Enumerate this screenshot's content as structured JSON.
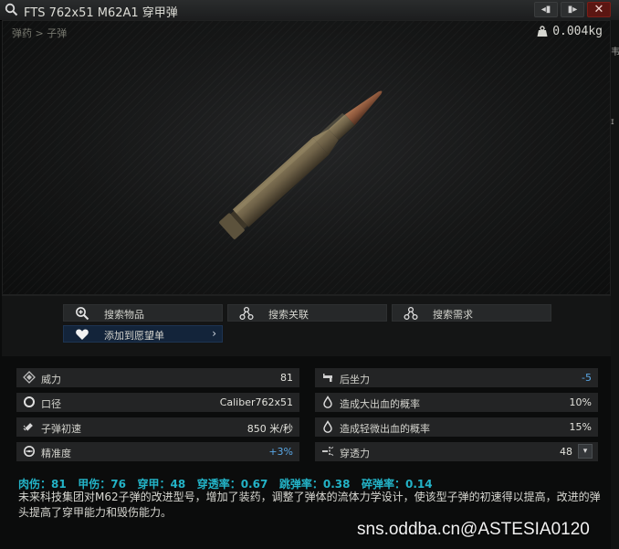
{
  "window": {
    "title": "FTS 762x51 M62A1 穿甲弹",
    "btn_left_glyph": "◂▮",
    "btn_right_glyph": "▮▸",
    "btn_close_glyph": "✕",
    "edge_char_1": "韦",
    "edge_char_2": "ɪ"
  },
  "viewer": {
    "breadcrumb": "弹药 > 子弹",
    "weight": "0.004kg"
  },
  "actions": {
    "search_item": "搜索物品",
    "search_related": "搜索关联",
    "search_needs": "搜索需求",
    "add_wishlist": "添加到愿望单"
  },
  "stats": {
    "left": [
      {
        "label": "威力",
        "value": "81",
        "icon": "damage-icon"
      },
      {
        "label": "口径",
        "value": "Caliber762x51",
        "icon": "caliber-icon"
      },
      {
        "label": "子弹初速",
        "value": "850 米/秒",
        "icon": "bullet-velocity-icon"
      },
      {
        "label": "精准度",
        "value": "+3%",
        "icon": "accuracy-icon"
      }
    ],
    "right": [
      {
        "label": "后坐力",
        "value": "-5",
        "icon": "recoil-icon"
      },
      {
        "label": "造成大出血的概率",
        "value": "10%",
        "icon": "heavy-bleed-icon"
      },
      {
        "label": "造成轻微出血的概率",
        "value": "15%",
        "icon": "light-bleed-icon"
      },
      {
        "label": "穿透力",
        "value": "48",
        "icon": "penetration-icon"
      }
    ]
  },
  "ballistics": "肉伤：81   甲伤：76   穿甲：48   穿透率：0.67   跳弹率：0.38   碎弹率：0.14",
  "description": "未来科技集团对M62子弹的改进型号，增加了装药，调整了弹体的流体力学设计，使该型子弹的初速得以提高，改进的弹头提高了穿甲能力和毁伤能力。",
  "watermark": "sns.oddba.cn@ASTESIA0120",
  "colors": {
    "accent_cyan": "#23b3c7",
    "positive_blue": "#5aa7e6",
    "close_red": "#5b1612",
    "wishlist_blue": "#13243a"
  }
}
